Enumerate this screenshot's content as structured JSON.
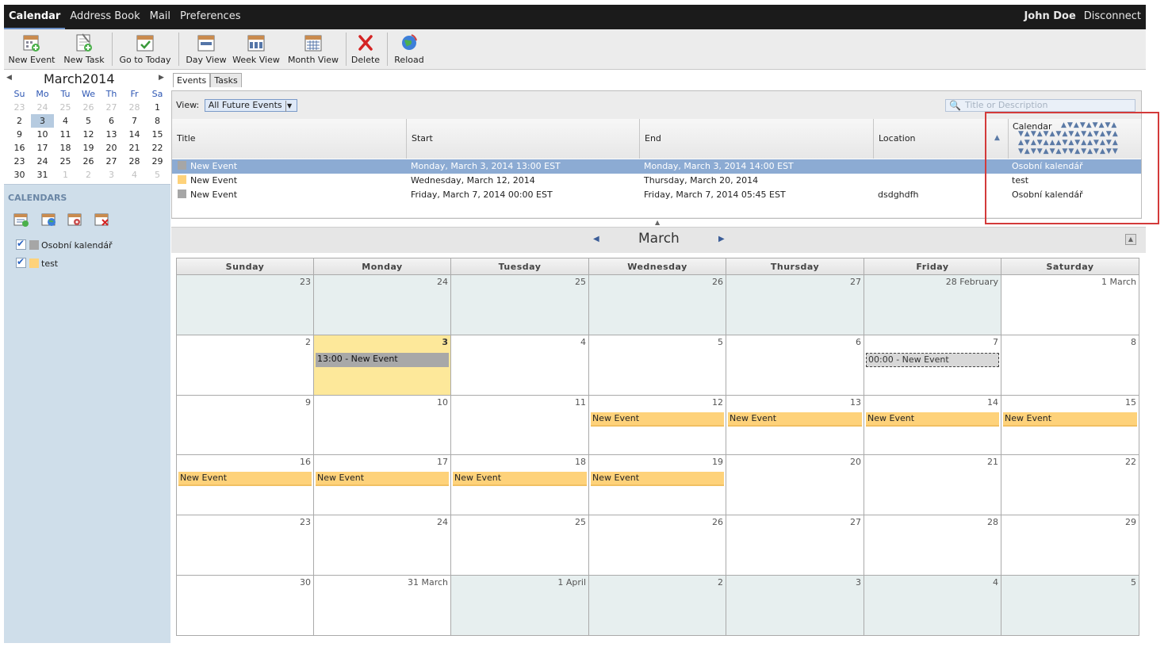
{
  "topbar": {
    "nav": [
      "Calendar",
      "Address Book",
      "Mail",
      "Preferences"
    ],
    "user": "John Doe",
    "disconnect": "Disconnect"
  },
  "toolbar": {
    "new_event": "New Event",
    "new_task": "New Task",
    "go_today": "Go to Today",
    "day_view": "Day View",
    "week_view": "Week View",
    "month_view": "Month View",
    "delete": "Delete",
    "reload": "Reload"
  },
  "minical": {
    "month": "March",
    "year": "2014",
    "dow": [
      "Su",
      "Mo",
      "Tu",
      "We",
      "Th",
      "Fr",
      "Sa"
    ],
    "weeks": [
      [
        "23",
        "24",
        "25",
        "26",
        "27",
        "28",
        "1"
      ],
      [
        "2",
        "3",
        "4",
        "5",
        "6",
        "7",
        "8"
      ],
      [
        "9",
        "10",
        "11",
        "12",
        "13",
        "14",
        "15"
      ],
      [
        "16",
        "17",
        "18",
        "19",
        "20",
        "21",
        "22"
      ],
      [
        "23",
        "24",
        "25",
        "26",
        "27",
        "28",
        "29"
      ],
      [
        "30",
        "31",
        "1",
        "2",
        "3",
        "4",
        "5"
      ]
    ]
  },
  "calendars": {
    "title": "CALENDARS",
    "items": [
      {
        "label": "Osobní kalendář",
        "color": "#a6a6a6"
      },
      {
        "label": "test",
        "color": "#fed27a"
      }
    ]
  },
  "tabs": [
    "Events",
    "Tasks"
  ],
  "events_list": {
    "view_label": "View:",
    "view_value": "All Future Events",
    "search_placeholder": "Title or Description",
    "columns": [
      "Title",
      "Start",
      "End",
      "Location",
      "Calendar"
    ],
    "rows": [
      {
        "title": "New Event",
        "start": "Monday, March 3, 2014 13:00 EST",
        "end": "Monday, March 3, 2014 14:00 EST",
        "location": "",
        "calendar": "Osobní kalendář",
        "color": "#a6a6a6"
      },
      {
        "title": "New Event",
        "start": "Wednesday, March 12, 2014",
        "end": "Thursday, March 20, 2014",
        "location": "",
        "calendar": "test",
        "color": "#fed27a"
      },
      {
        "title": "New Event",
        "start": "Friday, March 7, 2014 00:00 EST",
        "end": "Friday, March 7, 2014 05:45 EST",
        "location": "dsdghdfh",
        "calendar": "Osobní kalendář",
        "color": "#a6a6a6"
      }
    ]
  },
  "month_view": {
    "title": "March",
    "dow": [
      "Sunday",
      "Monday",
      "Tuesday",
      "Wednesday",
      "Thursday",
      "Friday",
      "Saturday"
    ],
    "weeks": [
      [
        "23",
        "24",
        "25",
        "26",
        "27",
        "28 February",
        "1 March"
      ],
      [
        "2",
        "3",
        "4",
        "5",
        "6",
        "7",
        "8"
      ],
      [
        "9",
        "10",
        "11",
        "12",
        "13",
        "14",
        "15"
      ],
      [
        "16",
        "17",
        "18",
        "19",
        "20",
        "21",
        "22"
      ],
      [
        "23",
        "24",
        "25",
        "26",
        "27",
        "28",
        "29"
      ],
      [
        "30",
        "31 March",
        "1 April",
        "2",
        "3",
        "4",
        "5"
      ]
    ],
    "events": {
      "mon3": "13:00 - New Event",
      "fri7": "00:00 - New Event",
      "multi": "New Event"
    }
  }
}
